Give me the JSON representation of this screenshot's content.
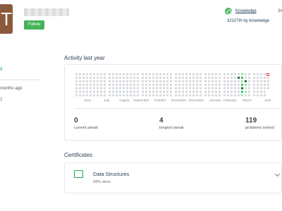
{
  "profile": {
    "avatar_initial": "T",
    "follow_label": "Follow"
  },
  "badge": {
    "name": "Knowledge",
    "rank": "32107th by knowledge",
    "cut_number": "34"
  },
  "left": {
    "link_fragment": "g",
    "months_fragment": "months ago",
    "small_fragment": "2"
  },
  "activity": {
    "title": "Activity last year",
    "months": [
      "June",
      "July",
      "August",
      "September",
      "October",
      "November",
      "December",
      "January",
      "February",
      "March",
      "April"
    ],
    "stats": [
      {
        "value": "0",
        "label": "current streak"
      },
      {
        "value": "4",
        "label": "longest streak"
      },
      {
        "value": "119",
        "label": "problems solved"
      }
    ],
    "colors": {
      "empty": "#d7dade",
      "low": "#9be9a8",
      "mid": "#40c463",
      "high": "#216e39"
    }
  },
  "certificates": {
    "title": "Certificates",
    "items": [
      {
        "name": "Data Structures",
        "progress": "68% done",
        "icon": "certificate-icon"
      }
    ]
  }
}
